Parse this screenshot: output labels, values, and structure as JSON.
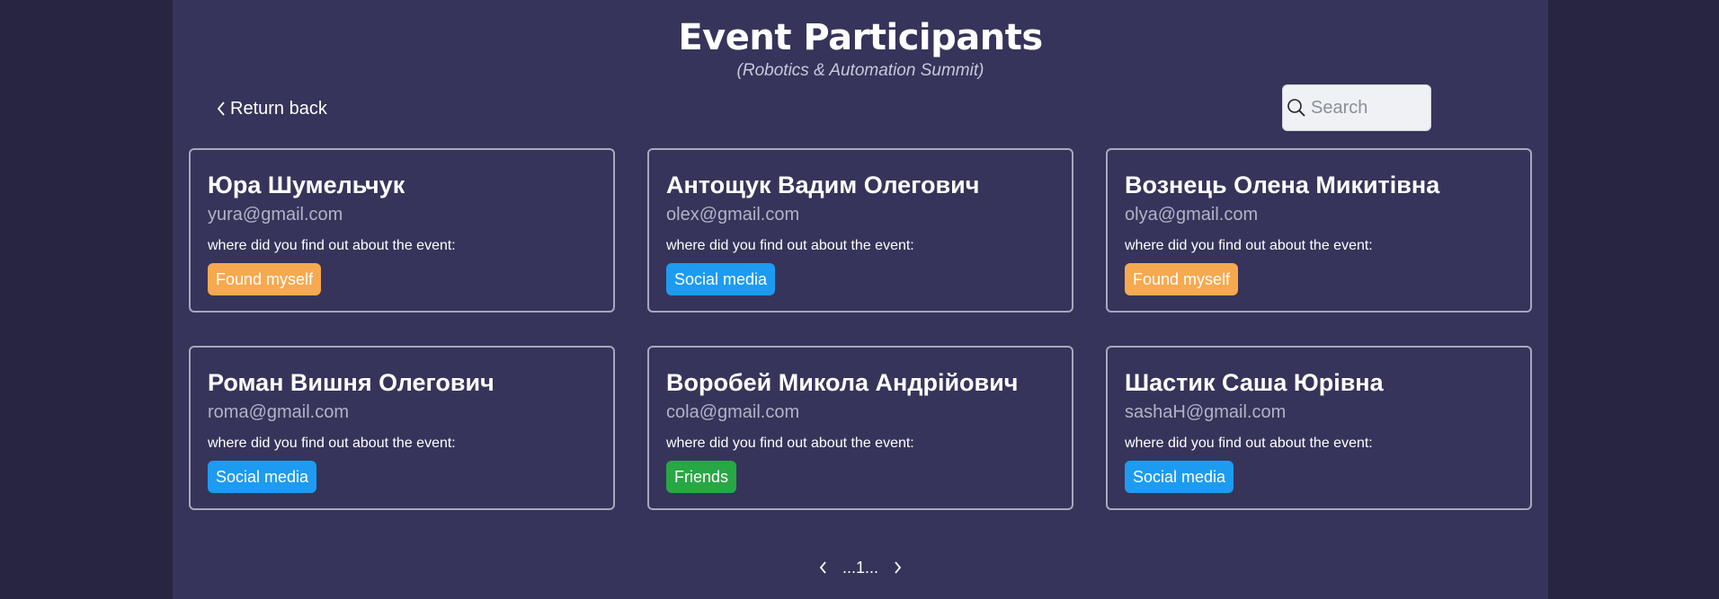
{
  "header": {
    "title": "Event Participants",
    "subtitle": "(Robotics & Automation Summit)"
  },
  "nav": {
    "back_label": "Return back"
  },
  "search": {
    "placeholder": "Search",
    "value": ""
  },
  "question_label": "where did you find out about the event:",
  "participants": [
    {
      "name": "Юра Шумельчук",
      "email": "yura@gmail.com",
      "source": "Found myself",
      "color": "#f6a94f"
    },
    {
      "name": "Антощук Вадим Олегович",
      "email": "olex@gmail.com",
      "source": "Social media",
      "color": "#1d9bf0"
    },
    {
      "name": "Вознець Олена Микитівна",
      "email": "olya@gmail.com",
      "source": "Found myself",
      "color": "#f6a94f"
    },
    {
      "name": "Роман Вишня Олегович",
      "email": "roma@gmail.com",
      "source": "Social media",
      "color": "#1d9bf0"
    },
    {
      "name": "Воробей Микола Андрійович",
      "email": "cola@gmail.com",
      "source": "Friends",
      "color": "#28a745"
    },
    {
      "name": "Шастик Саша Юрівна",
      "email": "sashaH@gmail.com",
      "source": "Social media",
      "color": "#1d9bf0"
    }
  ],
  "pagination": {
    "label": "...1..."
  },
  "colors": {
    "background": "#272540",
    "panel": "#36345a"
  }
}
